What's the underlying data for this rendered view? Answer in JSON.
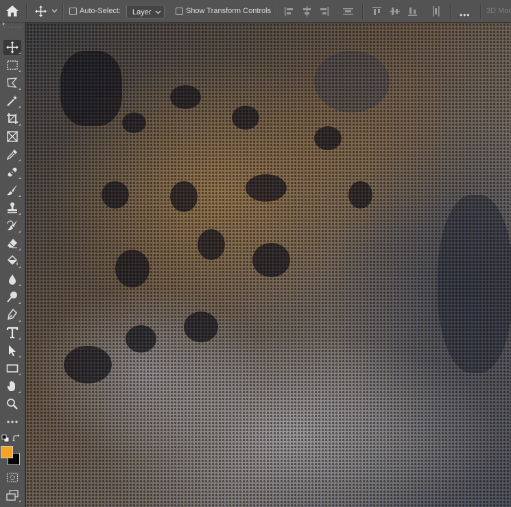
{
  "options_bar": {
    "auto_select_label": "Auto-Select:",
    "auto_select_checked": false,
    "layer_select_value": "Layer",
    "show_transform_label": "Show Transform Controls",
    "show_transform_checked": false,
    "more_label": "•••",
    "mode_3d_label": "3D Mod"
  },
  "toolbar": {
    "collapse_label": "››",
    "tools": [
      {
        "name": "move-tool",
        "icon": "move-icon",
        "selected": true
      },
      {
        "name": "rectangular-marquee-tool",
        "icon": "marquee-icon"
      },
      {
        "name": "lasso-tool",
        "icon": "polygonal-lasso-icon"
      },
      {
        "name": "magic-wand-tool",
        "icon": "magic-wand-icon"
      },
      {
        "name": "crop-tool",
        "icon": "crop-icon"
      },
      {
        "name": "frame-tool",
        "icon": "frame-icon"
      },
      {
        "name": "eyedropper-tool",
        "icon": "eyedropper-icon"
      },
      {
        "name": "healing-brush-tool",
        "icon": "bandage-icon"
      },
      {
        "name": "brush-tool",
        "icon": "brush-icon"
      },
      {
        "name": "clone-stamp-tool",
        "icon": "stamp-icon"
      },
      {
        "name": "history-brush-tool",
        "icon": "history-brush-icon"
      },
      {
        "name": "eraser-tool",
        "icon": "eraser-icon"
      },
      {
        "name": "paint-bucket-tool",
        "icon": "paint-bucket-icon"
      },
      {
        "name": "blur-tool",
        "icon": "drop-icon"
      },
      {
        "name": "dodge-tool",
        "icon": "dodge-icon"
      },
      {
        "name": "pen-tool",
        "icon": "pen-icon"
      },
      {
        "name": "type-tool",
        "icon": "type-icon",
        "label": "T"
      },
      {
        "name": "path-selection-tool",
        "icon": "arrow-icon"
      },
      {
        "name": "rectangle-tool",
        "icon": "rectangle-icon"
      },
      {
        "name": "hand-tool",
        "icon": "hand-icon"
      },
      {
        "name": "zoom-tool",
        "icon": "zoom-icon"
      },
      {
        "name": "edit-toolbar",
        "icon": "ellipsis-icon",
        "label": "•••"
      }
    ],
    "foreground_color": "#f7a320",
    "background_color": "#050505"
  },
  "canvas": {
    "image_subject": "halftone-leopard-photo"
  }
}
